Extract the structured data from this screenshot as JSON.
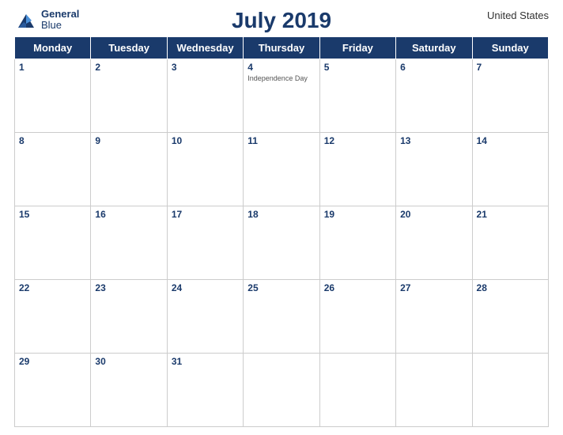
{
  "header": {
    "logo_line1": "General",
    "logo_line2": "Blue",
    "month_year": "July 2019",
    "country": "United States"
  },
  "days_of_week": [
    "Monday",
    "Tuesday",
    "Wednesday",
    "Thursday",
    "Friday",
    "Saturday",
    "Sunday"
  ],
  "weeks": [
    [
      {
        "day": 1,
        "holiday": ""
      },
      {
        "day": 2,
        "holiday": ""
      },
      {
        "day": 3,
        "holiday": ""
      },
      {
        "day": 4,
        "holiday": "Independence Day"
      },
      {
        "day": 5,
        "holiday": ""
      },
      {
        "day": 6,
        "holiday": ""
      },
      {
        "day": 7,
        "holiday": ""
      }
    ],
    [
      {
        "day": 8,
        "holiday": ""
      },
      {
        "day": 9,
        "holiday": ""
      },
      {
        "day": 10,
        "holiday": ""
      },
      {
        "day": 11,
        "holiday": ""
      },
      {
        "day": 12,
        "holiday": ""
      },
      {
        "day": 13,
        "holiday": ""
      },
      {
        "day": 14,
        "holiday": ""
      }
    ],
    [
      {
        "day": 15,
        "holiday": ""
      },
      {
        "day": 16,
        "holiday": ""
      },
      {
        "day": 17,
        "holiday": ""
      },
      {
        "day": 18,
        "holiday": ""
      },
      {
        "day": 19,
        "holiday": ""
      },
      {
        "day": 20,
        "holiday": ""
      },
      {
        "day": 21,
        "holiday": ""
      }
    ],
    [
      {
        "day": 22,
        "holiday": ""
      },
      {
        "day": 23,
        "holiday": ""
      },
      {
        "day": 24,
        "holiday": ""
      },
      {
        "day": 25,
        "holiday": ""
      },
      {
        "day": 26,
        "holiday": ""
      },
      {
        "day": 27,
        "holiday": ""
      },
      {
        "day": 28,
        "holiday": ""
      }
    ],
    [
      {
        "day": 29,
        "holiday": ""
      },
      {
        "day": 30,
        "holiday": ""
      },
      {
        "day": 31,
        "holiday": ""
      },
      {
        "day": null,
        "holiday": ""
      },
      {
        "day": null,
        "holiday": ""
      },
      {
        "day": null,
        "holiday": ""
      },
      {
        "day": null,
        "holiday": ""
      }
    ]
  ]
}
